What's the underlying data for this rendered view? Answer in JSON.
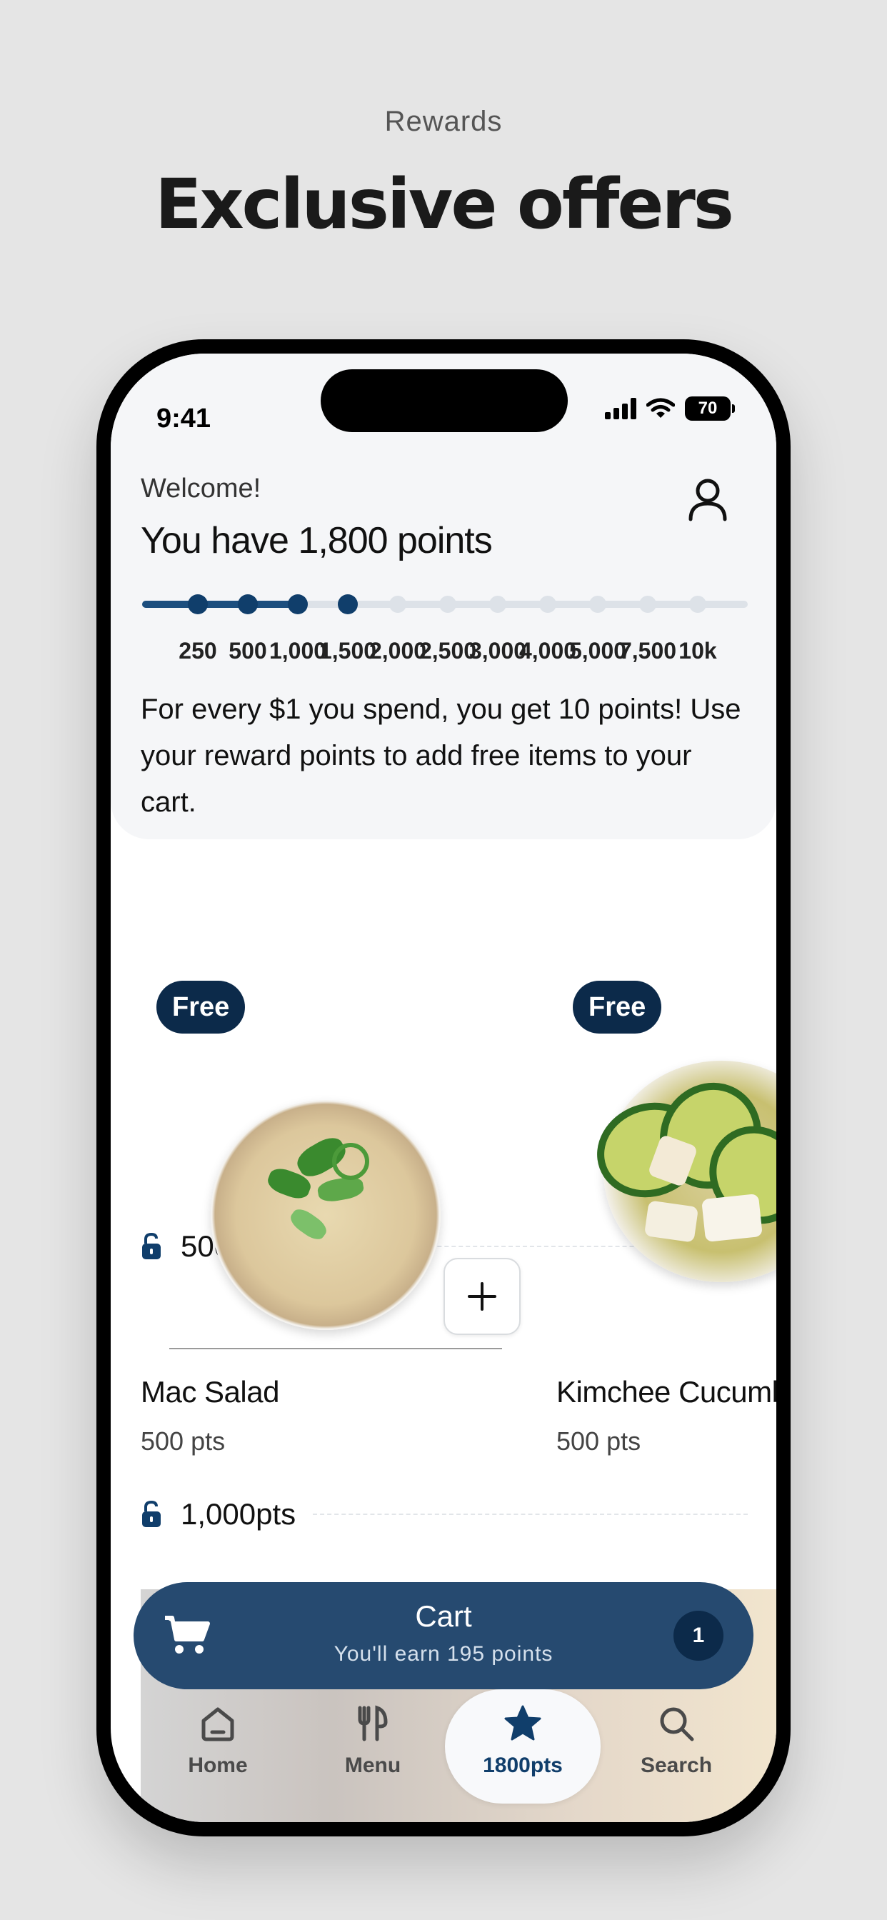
{
  "page": {
    "subtitle": "Rewards",
    "title": "Exclusive offers"
  },
  "status_bar": {
    "time": "9:41",
    "battery": "70"
  },
  "header": {
    "greeting": "Welcome!",
    "points_text": "You have 1,800 points",
    "progress": {
      "milestones": [
        "250",
        "500",
        "1,000",
        "1,500",
        "2,000",
        "2,500",
        "3,000",
        "4,000",
        "5,000",
        "7,500",
        "10k"
      ],
      "achieved_count": 4
    },
    "info": "For every $1 you spend, you get 10 points! Use your reward points to add free items to your cart."
  },
  "tiers": [
    {
      "label": "500pts"
    },
    {
      "label": "1,000pts"
    }
  ],
  "items": [
    {
      "badge": "Free",
      "name": "Mac Salad",
      "points": "500 pts"
    },
    {
      "badge": "Free",
      "name": "Kimchee Cucumber",
      "points": "500 pts"
    }
  ],
  "cart": {
    "title": "Cart",
    "subtitle": "You'll earn 195 points",
    "count": "1"
  },
  "tabs": [
    {
      "label": "Home",
      "icon": "home-icon"
    },
    {
      "label": "Menu",
      "icon": "utensils-icon"
    },
    {
      "label": "1800pts",
      "icon": "star-icon",
      "active": true
    },
    {
      "label": "Search",
      "icon": "search-icon"
    }
  ],
  "colors": {
    "accent": "#103e6b",
    "cart_bg": "#264a70",
    "badge_bg": "#0c2a4a"
  }
}
